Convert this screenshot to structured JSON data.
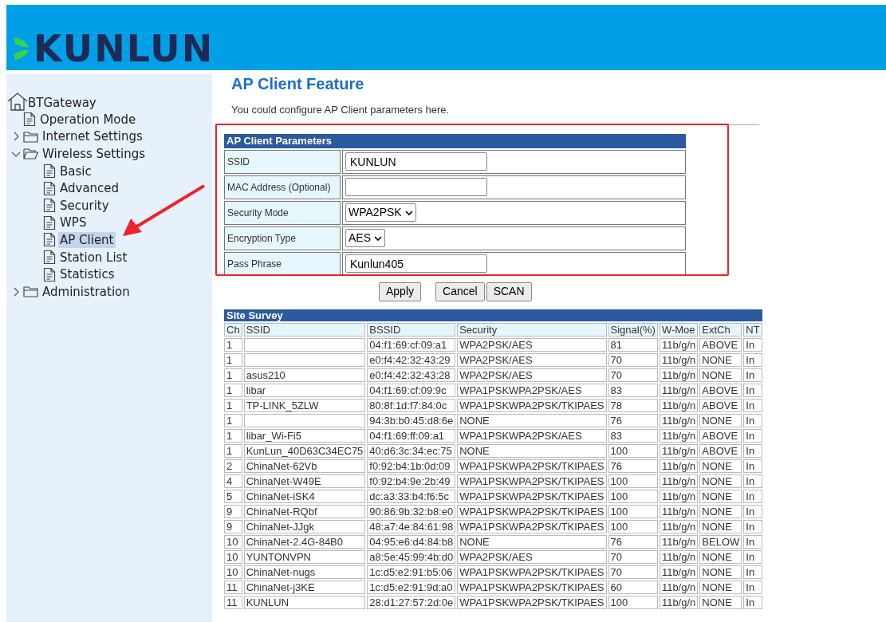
{
  "header": {
    "logo": "KUNLUN"
  },
  "sidebar": {
    "root": "BTGateway",
    "items": [
      {
        "label": "Operation Mode",
        "kind": "page",
        "selected": false
      },
      {
        "label": "Internet Settings",
        "kind": "folder",
        "expanded": false,
        "selected": false
      },
      {
        "label": "Wireless Settings",
        "kind": "folder",
        "expanded": true,
        "selected": false,
        "children": [
          {
            "label": "Basic",
            "kind": "page",
            "selected": false
          },
          {
            "label": "Advanced",
            "kind": "page",
            "selected": false
          },
          {
            "label": "Security",
            "kind": "page",
            "selected": false
          },
          {
            "label": "WPS",
            "kind": "page",
            "selected": false
          },
          {
            "label": "AP Client",
            "kind": "page",
            "selected": true
          },
          {
            "label": "Station List",
            "kind": "page",
            "selected": false
          },
          {
            "label": "Statistics",
            "kind": "page",
            "selected": false
          }
        ]
      },
      {
        "label": "Administration",
        "kind": "folder",
        "expanded": false,
        "selected": false
      }
    ]
  },
  "page": {
    "title": "AP Client Feature",
    "description": "You could configure AP Client parameters here."
  },
  "form": {
    "title": "AP Client Parameters",
    "rows": [
      {
        "label": "SSID",
        "kind": "text",
        "value": "KUNLUN"
      },
      {
        "label": "MAC Address (Optional)",
        "kind": "text"
      },
      {
        "label": "Security Mode",
        "kind": "select",
        "value": "WPA2PSK"
      },
      {
        "label": "Encryption Type",
        "kind": "select",
        "value": "AES"
      },
      {
        "label": "Pass Phrase",
        "kind": "text",
        "value": "Kunlun405"
      }
    ]
  },
  "buttons": [
    "Apply",
    "Cancel",
    "SCAN"
  ],
  "site_survey": {
    "title": "Site Survey",
    "columns": [
      "Ch",
      "SSID",
      "BSSID",
      "Security",
      "Signal(%)",
      "W-Moe",
      "ExtCh",
      "NT"
    ],
    "rows": [
      [
        "1",
        "",
        "04:f1:69:cf:09:a1",
        "WPA2PSK/AES",
        "81",
        "11b/g/n",
        "ABOVE",
        "In"
      ],
      [
        "1",
        "",
        "e0:f4:42:32:43:29",
        "WPA2PSK/AES",
        "70",
        "11b/g/n",
        "NONE",
        "In"
      ],
      [
        "1",
        "asus210",
        "e0:f4:42:32:43:28",
        "WPA2PSK/AES",
        "70",
        "11b/g/n",
        "NONE",
        "In"
      ],
      [
        "1",
        "libar",
        "04:f1:69:cf:09:9c",
        "WPA1PSKWPA2PSK/AES",
        "83",
        "11b/g/n",
        "ABOVE",
        "In"
      ],
      [
        "1",
        "TP-LINK_5ZLW",
        "80:8f:1d:f7:84:0c",
        "WPA1PSKWPA2PSK/TKIPAES",
        "78",
        "11b/g/n",
        "ABOVE",
        "In"
      ],
      [
        "1",
        "",
        "94:3b:b0:45:d8:6e",
        "NONE",
        "76",
        "11b/g/n",
        "NONE",
        "In"
      ],
      [
        "1",
        "libar_Wi-Fi5",
        "04:f1:69:ff:09:a1",
        "WPA1PSKWPA2PSK/AES",
        "83",
        "11b/g/n",
        "ABOVE",
        "In"
      ],
      [
        "1",
        "KunLun_40D63C34EC75",
        "40:d6:3c:34:ec:75",
        "NONE",
        "100",
        "11b/g/n",
        "ABOVE",
        "In"
      ],
      [
        "2",
        "ChinaNet-62Vb",
        "f0:92:b4:1b:0d:09",
        "WPA1PSKWPA2PSK/TKIPAES",
        "76",
        "11b/g/n",
        "NONE",
        "In"
      ],
      [
        "4",
        "ChinaNet-W49E",
        "f0:92:b4:9e:2b:49",
        "WPA1PSKWPA2PSK/TKIPAES",
        "100",
        "11b/g/n",
        "NONE",
        "In"
      ],
      [
        "5",
        "ChinaNet-iSK4",
        "dc:a3:33:b4:f6:5c",
        "WPA1PSKWPA2PSK/TKIPAES",
        "100",
        "11b/g/n",
        "NONE",
        "In"
      ],
      [
        "9",
        "ChinaNet-RQbf",
        "90:86:9b:32:b8:e0",
        "WPA1PSKWPA2PSK/TKIPAES",
        "100",
        "11b/g/n",
        "NONE",
        "In"
      ],
      [
        "9",
        "ChinaNet-JJgk",
        "48:a7:4e:84:61:98",
        "WPA1PSKWPA2PSK/TKIPAES",
        "100",
        "11b/g/n",
        "NONE",
        "In"
      ],
      [
        "10",
        "ChinaNet-2.4G-84B0",
        "04:95:e6:d4:84:b8",
        "NONE",
        "76",
        "11b/g/n",
        "BELOW",
        "In"
      ],
      [
        "10",
        "YUNTONVPN",
        "a8:5e:45:99:4b:d0",
        "WPA2PSK/AES",
        "70",
        "11b/g/n",
        "NONE",
        "In"
      ],
      [
        "10",
        "ChinaNet-nugs",
        "1c:d5:e2:91:b5:06",
        "WPA1PSKWPA2PSK/TKIPAES",
        "70",
        "11b/g/n",
        "NONE",
        "In"
      ],
      [
        "11",
        "ChinaNet-j3KE",
        "1c:d5:e2:91:9d:a0",
        "WPA1PSKWPA2PSK/TKIPAES",
        "60",
        "11b/g/n",
        "NONE",
        "In"
      ],
      [
        "11",
        "KUNLUN",
        "28:d1:27:57:2d:0e",
        "WPA1PSKWPA2PSK/TKIPAES",
        "100",
        "11b/g/n",
        "NONE",
        "In"
      ]
    ]
  }
}
